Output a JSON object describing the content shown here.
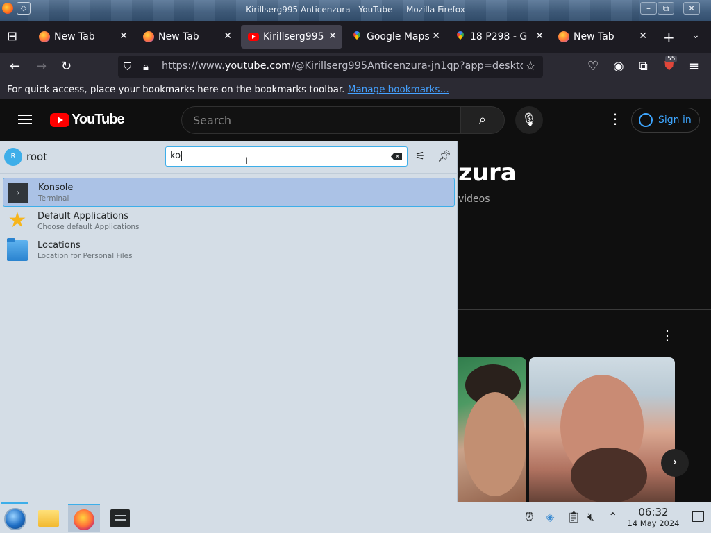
{
  "window": {
    "title": "Kirillserg995 Anticenzura - YouTube — Mozilla Firefox",
    "minimize": "–",
    "maximize": "⧉",
    "close": "✕"
  },
  "tabs": [
    {
      "label": "New Tab",
      "favicon": "firefox-icon",
      "active": false
    },
    {
      "label": "New Tab",
      "favicon": "firefox-icon",
      "active": false
    },
    {
      "label": "Kirillserg995",
      "favicon": "youtube-icon",
      "active": true
    },
    {
      "label": "Google Maps",
      "favicon": "google-maps-icon",
      "active": false
    },
    {
      "label": "18 P298 - Goo",
      "favicon": "google-maps-icon",
      "active": false
    },
    {
      "label": "New Tab",
      "favicon": "firefox-icon",
      "active": false
    }
  ],
  "tab_close_glyph": "✕",
  "navbar": {
    "url_prefix": "https://www.",
    "url_domain": "youtube.com",
    "url_rest": "/@Kirillserg995Anticenzura-jn1qp?app=desktop",
    "extension_badge": "55"
  },
  "bookmarks": {
    "message": "For quick access, place your bookmarks here on the bookmarks toolbar.",
    "link": "Manage bookmarks…"
  },
  "youtube": {
    "logo_text": "YouTube",
    "search_placeholder": "Search",
    "signin_label": "Sign in",
    "channel_title_visible": "zura",
    "videos_label": "videos"
  },
  "krunner": {
    "avatar_initial": "R",
    "user": "root",
    "query": "ko",
    "results": [
      {
        "title": "Konsole",
        "subtitle": "Terminal",
        "icon": "konsole-icon",
        "selected": true
      },
      {
        "title": "Default Applications",
        "subtitle": "Choose default Applications",
        "icon": "star-icon",
        "selected": false
      },
      {
        "title": "Locations",
        "subtitle": "Location for Personal Files",
        "icon": "folder-icon",
        "selected": false
      }
    ]
  },
  "taskbar": {
    "time": "06:32",
    "date": "14 May 2024"
  },
  "colors": {
    "accent": "#3daee9",
    "selection": "#abc2e6",
    "youtube_red": "#ff0000",
    "link_blue": "#45a1ff",
    "panel_bg": "#d4dde6"
  }
}
